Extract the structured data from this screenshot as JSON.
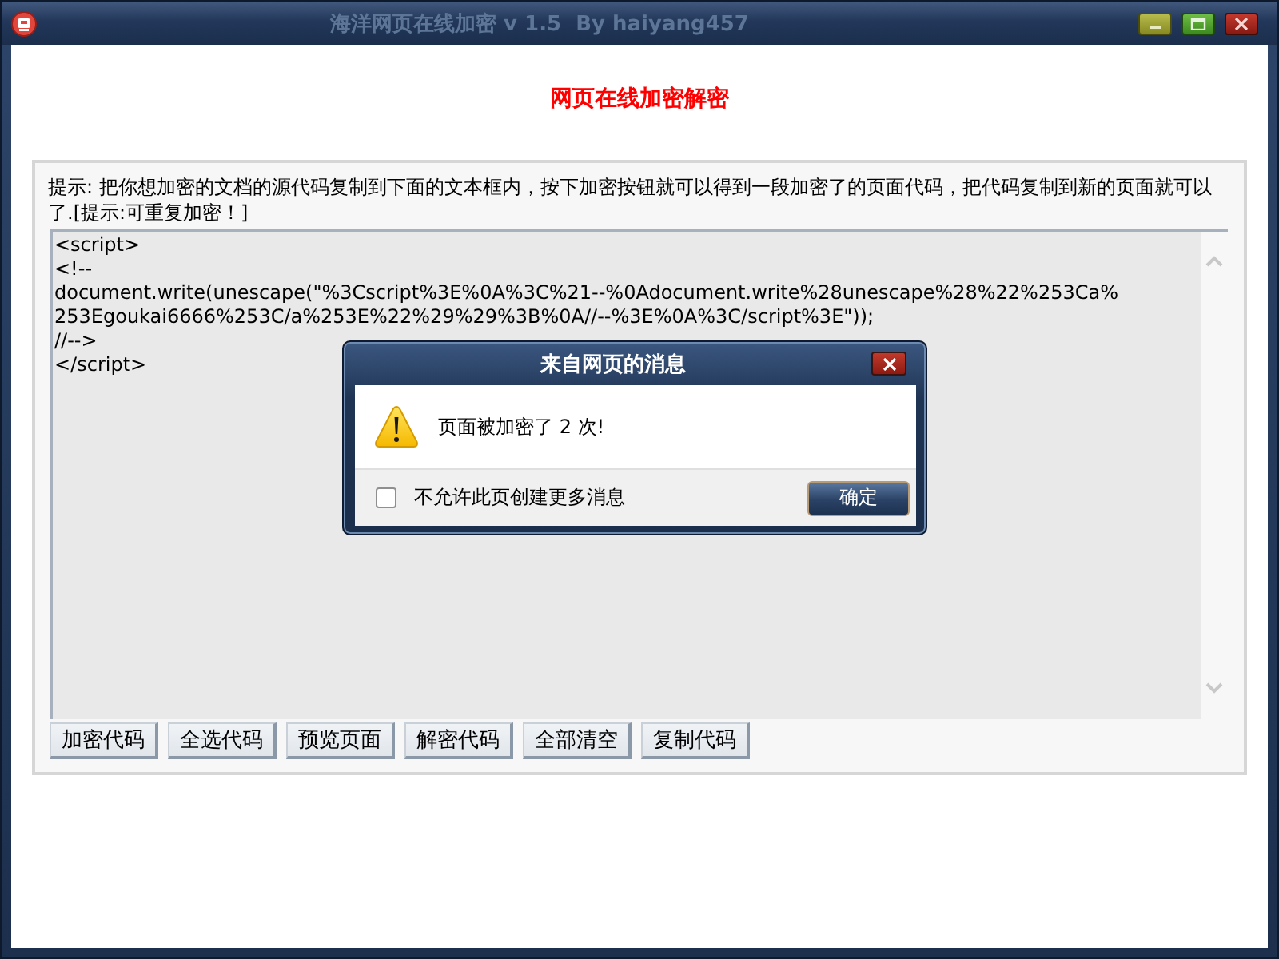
{
  "window": {
    "title": "海洋网页在线加密 v 1.5  By haiyang457"
  },
  "heading": "网页在线加密解密",
  "panel": {
    "hint": "提示: 把你想加密的文档的源代码复制到下面的文本框内，按下加密按钮就可以得到一段加密了的页面代码，把代码复制到新的页面就可以了.[提示:可重复加密！]",
    "code_lines": [
      "<script>",
      "<!--",
      "document.write(unescape(\"%3Cscript%3E%0A%3C%21--%0Adocument.write%28unescape%28%22%253Ca%",
      "253Egoukai6666%253C/a%253E%22%29%29%3B%0A//--%3E%0A%3C/script%3E\"));",
      "//-->",
      "</script>"
    ],
    "buttons": [
      "加密代码",
      "全选代码",
      "预览页面",
      "解密代码",
      "全部清空",
      "复制代码"
    ]
  },
  "dialog": {
    "title": "来自网页的消息",
    "message": "页面被加密了 2 次!",
    "checkbox": {
      "label": "不允许此页创建更多消息",
      "checked": false
    },
    "button": "确定"
  }
}
